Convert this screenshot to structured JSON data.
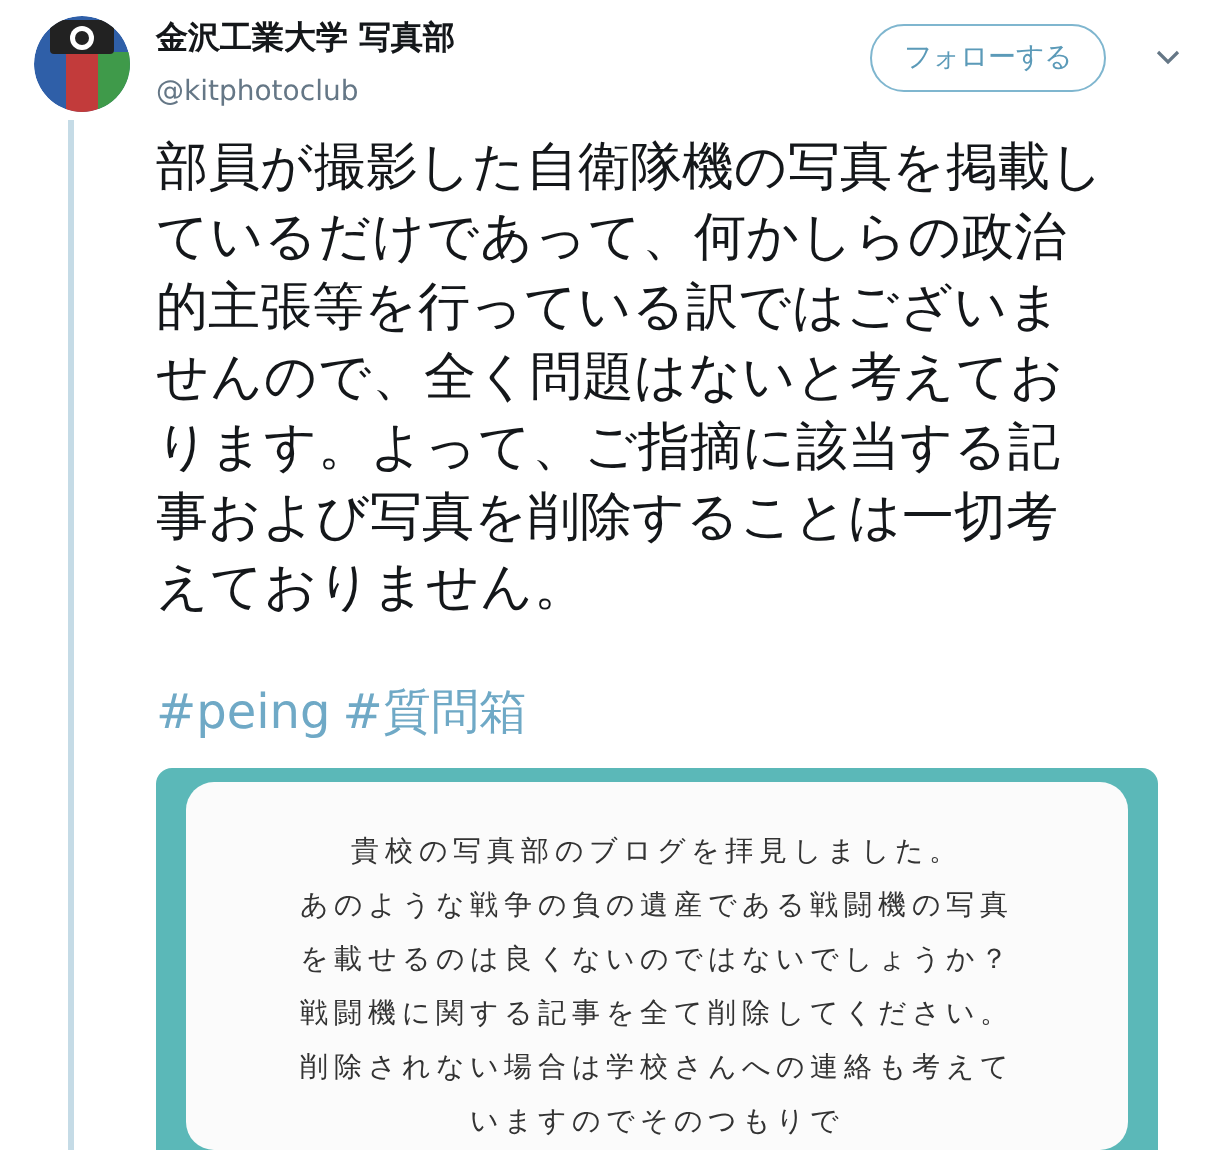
{
  "author": {
    "name": "金沢工業大学 写真部",
    "handle": "@kitphotoclub"
  },
  "follow_button": {
    "label": "フォローする"
  },
  "tweet_text": "部員が撮影した自衛隊機の写真を掲載しているだけであって、何かしらの政治的主張等を行っている訳ではございませんので、全く問題はないと考えております。よって、ご指摘に該当する記事および写真を削除することは一切考えておりません。",
  "hashtags": [
    "#peing",
    "#質問箱"
  ],
  "question_card": {
    "lines": [
      "貴校の写真部のブログを拝見しました。",
      "あのような戦争の負の遺産である戦闘機の写真",
      "を載せるのは良くないのではないでしょうか？",
      "戦闘機に関する記事を全て削除してください。",
      "削除されない場合は学校さんへの連絡も考えて",
      "いますのでそのつもりで"
    ]
  }
}
